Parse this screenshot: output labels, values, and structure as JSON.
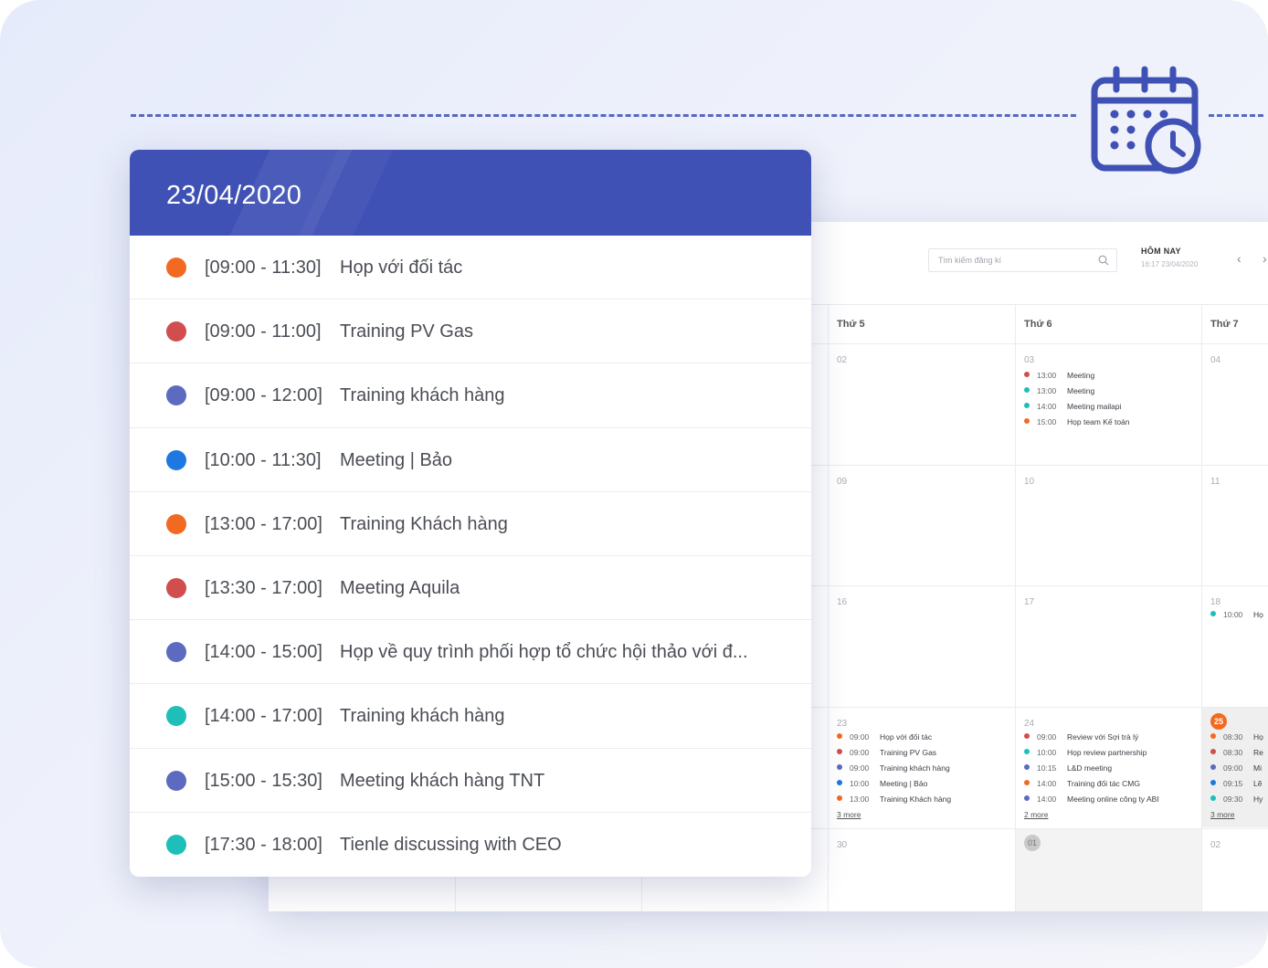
{
  "colors": {
    "primary": "#3f51b5",
    "orange": "#f26a21",
    "red": "#d04e4e",
    "indigo": "#5c6bc0",
    "blue": "#1e78e0",
    "teal": "#1dbfb8"
  },
  "icon": "calendar-clock-icon",
  "card": {
    "date": "23/04/2020",
    "events": [
      {
        "time": "[09:00 - 11:30]",
        "title": "Họp với đối tác",
        "color": "#f26a21"
      },
      {
        "time": "[09:00 - 11:00]",
        "title": "Training PV Gas",
        "color": "#d04e4e"
      },
      {
        "time": "[09:00 - 12:00]",
        "title": "Training khách hàng",
        "color": "#5c6bc0"
      },
      {
        "time": "[10:00 - 11:30]",
        "title": "Meeting | Bảo",
        "color": "#1e78e0"
      },
      {
        "time": "[13:00 - 17:00]",
        "title": "Training Khách hàng",
        "color": "#f26a21"
      },
      {
        "time": "[13:30 - 17:00]",
        "title": "Meeting Aquila",
        "color": "#d04e4e"
      },
      {
        "time": "[14:00 - 15:00]",
        "title": "Họp về quy trình phối hợp tổ chức hội thảo với đ...",
        "color": "#5c6bc0"
      },
      {
        "time": "[14:00 - 17:00]",
        "title": "Training khách hàng",
        "color": "#1dbfb8"
      },
      {
        "time": "[15:00 - 15:30]",
        "title": "Meeting khách hàng TNT",
        "color": "#5c6bc0"
      },
      {
        "time": "[17:30 - 18:00]",
        "title": "Tienle discussing with CEO",
        "color": "#1dbfb8"
      }
    ]
  },
  "app": {
    "search_placeholder": "Tìm kiếm đăng kí",
    "today_label": "HÔM NAY",
    "today_sub": "16:17 23/04/2020",
    "prev": "‹",
    "next": "›",
    "day_names": [
      "Thứ 5",
      "Thứ 6",
      "Thứ 7"
    ],
    "hidden_text": "··· ·······  ·····  ········",
    "weeks": {
      "w1": {
        "thu": {
          "num": "02"
        },
        "fri": {
          "num": "03",
          "events": [
            {
              "time": "13:00",
              "title": "Meeting",
              "color": "#d04e4e"
            },
            {
              "time": "13:00",
              "title": "Meeting",
              "color": "#1dbfb8"
            },
            {
              "time": "14:00",
              "title": "Meeting mailapi",
              "color": "#1dbfb8"
            },
            {
              "time": "15:00",
              "title": "Họp team Kế toán",
              "color": "#f26a21"
            }
          ]
        },
        "sat": {
          "num": "04"
        }
      },
      "w2": {
        "thu": {
          "num": "09"
        },
        "fri": {
          "num": "10"
        },
        "sat": {
          "num": "11"
        }
      },
      "w3": {
        "thu": {
          "num": "16"
        },
        "fri": {
          "num": "17"
        },
        "sat": {
          "num": "18",
          "events": [
            {
              "time": "10:00",
              "title": "Họ",
              "color": "#1dbfb8"
            }
          ]
        }
      },
      "w4": {
        "thu": {
          "num": "23",
          "more": "3 more",
          "events": [
            {
              "time": "09:00",
              "title": "Họp với đối tác",
              "color": "#f26a21"
            },
            {
              "time": "09:00",
              "title": "Training PV Gas",
              "color": "#d04e4e"
            },
            {
              "time": "09:00",
              "title": "Training khách hàng",
              "color": "#5c6bc0"
            },
            {
              "time": "10:00",
              "title": "Meeting | Bảo",
              "color": "#1e78e0"
            },
            {
              "time": "13:00",
              "title": "Training Khách hàng",
              "color": "#f26a21"
            }
          ]
        },
        "fri": {
          "num": "24",
          "more": "2 more",
          "events": [
            {
              "time": "09:00",
              "title": "Review với Sợi trà lý",
              "color": "#d04e4e"
            },
            {
              "time": "10:00",
              "title": "Họp review partnership",
              "color": "#1dbfb8"
            },
            {
              "time": "10:15",
              "title": "L&D meeting",
              "color": "#5c6bc0"
            },
            {
              "time": "14:00",
              "title": "Training đối tác CMG",
              "color": "#f26a21"
            },
            {
              "time": "14:00",
              "title": "Meeting online công ty ABI",
              "color": "#5c6bc0"
            }
          ]
        },
        "sat": {
          "num": "25",
          "more": "3 more",
          "events": [
            {
              "time": "08:30",
              "title": "Họ",
              "color": "#f26a21"
            },
            {
              "time": "08:30",
              "title": "Re",
              "color": "#d04e4e"
            },
            {
              "time": "09:00",
              "title": "Mi",
              "color": "#5c6bc0"
            },
            {
              "time": "09:15",
              "title": "Lẽ",
              "color": "#1e78e0"
            },
            {
              "time": "09:30",
              "title": "Hy",
              "color": "#1dbfb8"
            }
          ]
        }
      },
      "w5": {
        "thu": {
          "num": "30"
        },
        "fri": {
          "num": "01"
        },
        "sat": {
          "num": "02"
        }
      }
    }
  }
}
